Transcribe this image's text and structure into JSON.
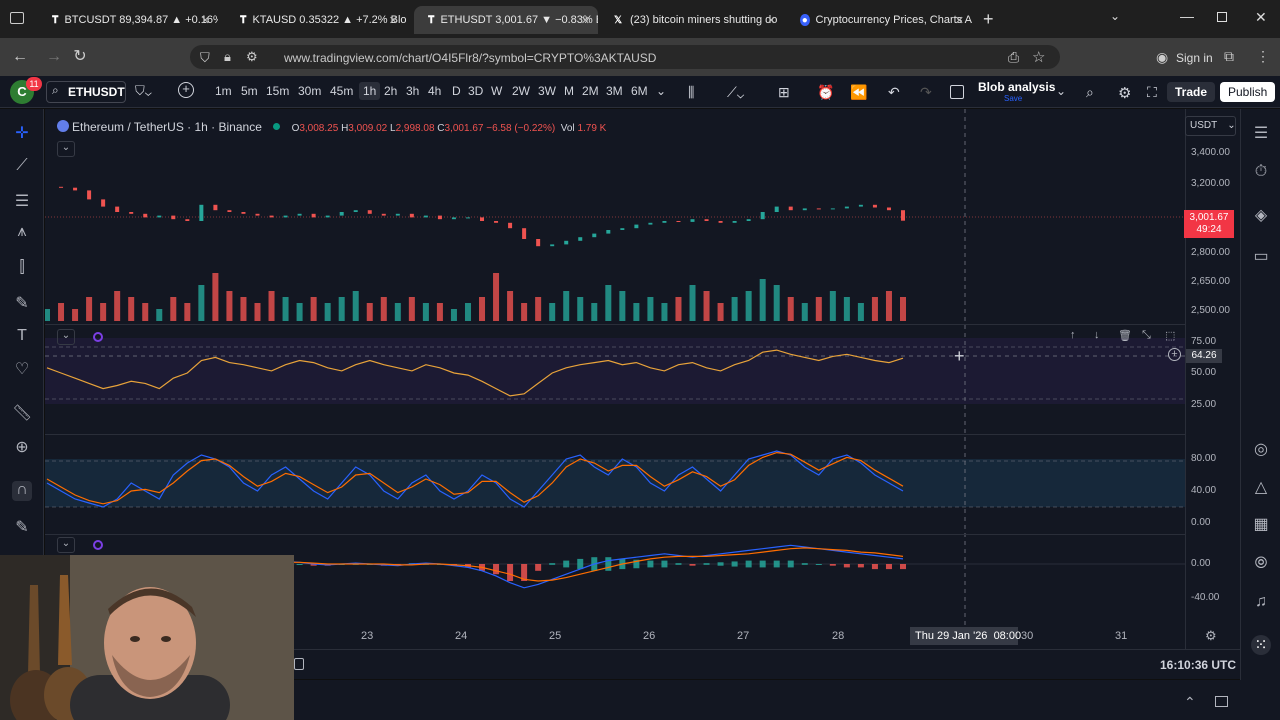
{
  "browser": {
    "tabs": [
      {
        "title": "BTCUSDT 89,394.87 ▲ +0.16% B",
        "icon": "tradingview-icon"
      },
      {
        "title": "KTAUSD 0.35322 ▲ +7.2% Blob",
        "icon": "tradingview-icon"
      },
      {
        "title": "ETHUSDT 3,001.67 ▼ −0.83% B",
        "icon": "tradingview-icon",
        "active": true
      },
      {
        "title": "(23) bitcoin miners shutting do",
        "icon": "x-icon"
      },
      {
        "title": "Cryptocurrency Prices, Charts A",
        "icon": "coinmarketcap-icon"
      }
    ],
    "url": "www.tradingview.com/chart/O4I5Flr8/?symbol=CRYPTO%3AKTAUSD",
    "signin": "Sign in"
  },
  "toolbar": {
    "avatar_letter": "C",
    "avatar_badge": "11",
    "symbol": "ETHUSDT",
    "intervals": [
      "1m",
      "5m",
      "15m",
      "30m",
      "45m",
      "1h",
      "2h",
      "3h",
      "4h",
      "D",
      "3D",
      "W",
      "2W",
      "3W",
      "M",
      "2M",
      "3M",
      "6M"
    ],
    "active_interval": "1h",
    "layout_name": "Blob analysis",
    "layout_sub": "Save",
    "trade": "Trade",
    "publish": "Publish"
  },
  "legend": {
    "pair": "Ethereum / TetherUS · 1h · Binance",
    "o_label": "O",
    "o": "3,008.25",
    "h_label": "H",
    "h": "3,009.02",
    "l_label": "L",
    "l": "2,998.08",
    "c_label": "C",
    "c": "3,001.67",
    "chg": "−6.58 (−0.22%)",
    "vol_label": "Vol",
    "vol": "1.79 K"
  },
  "price_axis": {
    "currency": "USDT",
    "labels": [
      "3,400.00",
      "3,200.00",
      "2,800.00",
      "2,650.00",
      "2,500.00"
    ],
    "current_price": "3,001.67",
    "countdown": "49:24"
  },
  "rsi_axis": {
    "labels": [
      "75.00",
      "50.00",
      "25.00"
    ],
    "current": "64.26"
  },
  "stoch_axis": {
    "labels": [
      "80.00",
      "40.00",
      "0.00"
    ]
  },
  "macd_axis": {
    "labels": [
      "0.00",
      "-40.00"
    ]
  },
  "time_axis": {
    "labels": [
      "23",
      "24",
      "25",
      "26",
      "27",
      "28",
      "30",
      "31"
    ],
    "crosshair": "Thu 29 Jan '26",
    "crosshair_time": "08:00"
  },
  "clock": "16:10:36 UTC",
  "colors": {
    "bg": "#131722",
    "up": "#26a69a",
    "down": "#ef5350",
    "rsi": "#e8a33a",
    "stoch_k": "#2962ff",
    "stoch_d": "#ff6d00"
  },
  "chart_data": {
    "type": "line",
    "title": "Ethereum / TetherUS · 1h · Binance",
    "x_range": [
      "22 Jan",
      "29 Jan"
    ],
    "price_ylim": [
      2500,
      3400
    ],
    "price_series": [
      3190,
      3185,
      3170,
      3120,
      3080,
      3050,
      3040,
      3020,
      3030,
      3010,
      3000,
      3090,
      3060,
      3050,
      3040,
      3030,
      3020,
      3030,
      3040,
      3020,
      3030,
      3050,
      3060,
      3040,
      3030,
      3040,
      3020,
      3030,
      3010,
      3020,
      3020,
      3000,
      2990,
      2960,
      2900,
      2860,
      2870,
      2890,
      2910,
      2930,
      2950,
      2960,
      2980,
      2990,
      3000,
      2995,
      3010,
      3000,
      2990,
      3000,
      3010,
      3050,
      3080,
      3060,
      3070,
      3065,
      3070,
      3080,
      3090,
      3075,
      3060,
      3001.67
    ],
    "volume_series": [
      2,
      3,
      2,
      4,
      3,
      5,
      4,
      3,
      2,
      4,
      3,
      6,
      8,
      5,
      4,
      3,
      5,
      4,
      3,
      4,
      3,
      4,
      5,
      3,
      4,
      3,
      4,
      3,
      3,
      2,
      3,
      4,
      8,
      5,
      3,
      4,
      3,
      5,
      4,
      3,
      6,
      5,
      3,
      4,
      3,
      4,
      6,
      5,
      3,
      4,
      5,
      7,
      6,
      4,
      3,
      4,
      5,
      4,
      3,
      4,
      5,
      4
    ],
    "rsi_series": [
      55,
      50,
      45,
      40,
      35,
      38,
      42,
      40,
      35,
      45,
      50,
      62,
      65,
      60,
      58,
      55,
      52,
      58,
      62,
      60,
      55,
      52,
      58,
      62,
      58,
      55,
      52,
      58,
      55,
      50,
      48,
      42,
      35,
      28,
      30,
      40,
      50,
      55,
      58,
      60,
      62,
      58,
      60,
      55,
      52,
      58,
      60,
      55,
      52,
      58,
      62,
      70,
      72,
      68,
      65,
      62,
      66,
      68,
      65,
      62,
      60,
      64.26
    ],
    "stoch_k": [
      50,
      40,
      30,
      25,
      20,
      30,
      50,
      40,
      30,
      60,
      75,
      85,
      80,
      70,
      50,
      40,
      60,
      70,
      55,
      40,
      30,
      50,
      70,
      60,
      40,
      30,
      50,
      60,
      40,
      30,
      40,
      60,
      50,
      30,
      20,
      40,
      60,
      80,
      85,
      70,
      60,
      80,
      70,
      50,
      40,
      60,
      70,
      55,
      40,
      60,
      80,
      85,
      90,
      85,
      70,
      60,
      80,
      85,
      75,
      60,
      50,
      40
    ],
    "stoch_d": [
      55,
      45,
      35,
      28,
      24,
      28,
      40,
      42,
      38,
      50,
      65,
      78,
      80,
      72,
      58,
      46,
      52,
      62,
      58,
      48,
      38,
      45,
      60,
      62,
      50,
      38,
      45,
      55,
      48,
      36,
      38,
      52,
      52,
      38,
      26,
      34,
      50,
      70,
      80,
      75,
      65,
      72,
      72,
      58,
      46,
      54,
      64,
      58,
      46,
      54,
      72,
      82,
      88,
      86,
      76,
      66,
      74,
      82,
      78,
      66,
      56,
      46
    ],
    "macd_line": [
      0,
      2,
      1,
      -2,
      -4,
      -6,
      -4,
      -2,
      -3,
      -5,
      -2,
      2,
      4,
      3,
      1,
      0,
      2,
      3,
      2,
      0,
      -1,
      0,
      1,
      0,
      -1,
      -2,
      0,
      1,
      0,
      -2,
      -4,
      -8,
      -14,
      -22,
      -28,
      -24,
      -18,
      -12,
      -6,
      0,
      4,
      6,
      8,
      10,
      12,
      10,
      8,
      10,
      12,
      14,
      16,
      18,
      20,
      22,
      20,
      18,
      16,
      14,
      12,
      10,
      8,
      6
    ],
    "macd_signal": [
      0,
      1,
      1,
      0,
      -2,
      -3,
      -4,
      -3,
      -3,
      -4,
      -3,
      -1,
      1,
      2,
      2,
      1,
      1,
      2,
      2,
      1,
      0,
      0,
      0,
      0,
      0,
      -1,
      -1,
      0,
      0,
      -1,
      -2,
      -4,
      -8,
      -12,
      -18,
      -20,
      -19,
      -16,
      -12,
      -8,
      -4,
      0,
      3,
      6,
      8,
      9,
      9,
      9,
      10,
      11,
      12,
      14,
      16,
      18,
      19,
      18,
      17,
      16,
      14,
      13,
      11,
      9
    ]
  }
}
